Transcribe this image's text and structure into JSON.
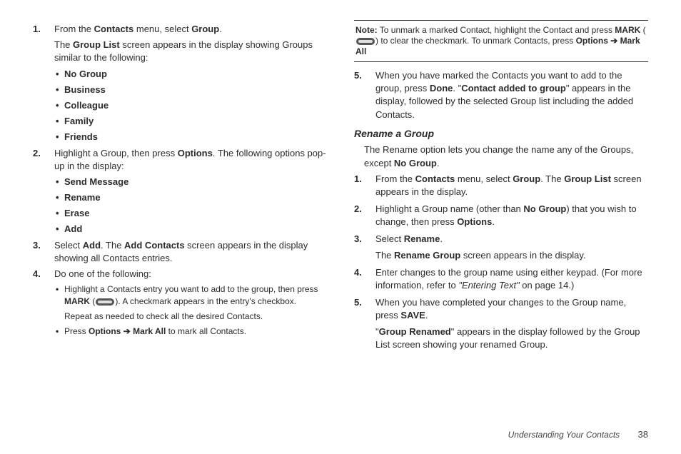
{
  "left": {
    "s1a_pre": "From the ",
    "s1a_b1": "Contacts",
    "s1a_mid": " menu, select ",
    "s1a_b2": "Group",
    "s1a_post": ".",
    "s1b_pre": "The ",
    "s1b_b": "Group List",
    "s1b_post": " screen appears in the display showing Groups similar to the following:",
    "groups": {
      "g0": "No Group",
      "g1": "Business",
      "g2": "Colleague",
      "g3": "Family",
      "g4": "Friends"
    },
    "s2a_pre": "Highlight a Group, then press ",
    "s2a_b": "Options",
    "s2a_post": ". The following options pop-up in the display:",
    "opts": {
      "o0": "Send Message",
      "o1": "Rename",
      "o2": "Erase",
      "o3": "Add"
    },
    "s3_pre": "Select ",
    "s3_b1": "Add",
    "s3_mid": ". The ",
    "s3_b2": "Add Contacts",
    "s3_post": " screen appears in the display showing all Contacts entries.",
    "s4_title": "Do one of the following:",
    "s4a_pre": "Highlight a Contacts entry you want to add to the group, then press ",
    "s4a_b": "MARK",
    "s4a_mid": " (",
    "s4a_post": "). A checkmark appears in the entry's checkbox.",
    "s4a_repeat": "Repeat as needed to check all the desired Contacts.",
    "s4b_pre": "Press ",
    "s4b_b1": "Options",
    "s4b_arrow": " ➔ ",
    "s4b_b2": "Mark All",
    "s4b_post": " to mark all Contacts."
  },
  "right": {
    "note_b": "Note:",
    "note_pre": " To unmark a marked Contact, highlight the Contact and press ",
    "note_b1": "MARK",
    "note_mid": " (",
    "note_post1": ") to clear the checkmark. To unmark Contacts, press ",
    "note_b2": "Options",
    "note_arrow": " ➔ ",
    "note_b3": "Mark All",
    "s5_pre": "When you have marked the Contacts you want to add to the group, press ",
    "s5_b1": "Done",
    "s5_mid": ". \"",
    "s5_b2": "Contact added to group",
    "s5_post": "\" appears in the display, followed by the selected Group list including the added Contacts.",
    "heading": "Rename a Group",
    "intro_pre": "The Rename option lets you change the name any of the Groups, except ",
    "intro_b": "No Group",
    "intro_post": ".",
    "r1_pre": "From the ",
    "r1_b1": "Contacts",
    "r1_mid": " menu, select ",
    "r1_b2": "Group",
    "r1_mid2": ". The ",
    "r1_b3": "Group List",
    "r1_post": " screen appears in the display.",
    "r2_pre": "Highlight a Group name (other than ",
    "r2_b": "No Group",
    "r2_mid": ") that you wish to change, then press ",
    "r2_b2": "Options",
    "r2_post": ".",
    "r3_pre": "Select ",
    "r3_b": "Rename",
    "r3_post": ".",
    "r3b_pre": "The ",
    "r3b_b": "Rename Group",
    "r3b_post": " screen appears in the display.",
    "r4_pre": "Enter changes to the group name using either keypad. (For more information, refer to ",
    "r4_i": "\"Entering Text\" ",
    "r4_post": " on page 14.)",
    "r5_pre": "When you have completed your changes to the Group name, press ",
    "r5_b": "SAVE",
    "r5_post": ".",
    "r5b_pre": "\"",
    "r5b_b": "Group Renamed",
    "r5b_post": "\" appears in the display followed by the Group List screen showing your renamed Group."
  },
  "nums": {
    "n1": "1.",
    "n2": "2.",
    "n3": "3.",
    "n4": "4.",
    "n5": "5."
  },
  "footer": {
    "title": "Understanding Your Contacts",
    "page": "38"
  }
}
